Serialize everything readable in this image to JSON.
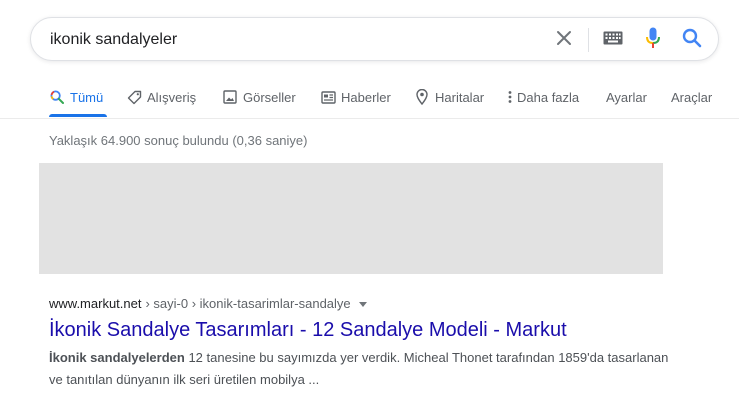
{
  "search": {
    "query": "ikonik sandalyeler"
  },
  "tabs": [
    {
      "label": "Tümü",
      "icon": "search-icon",
      "active": true
    },
    {
      "label": "Alışveriş",
      "icon": "tag-icon"
    },
    {
      "label": "Görseller",
      "icon": "image-icon"
    },
    {
      "label": "Haberler",
      "icon": "news-icon"
    },
    {
      "label": "Haritalar",
      "icon": "map-pin-icon"
    },
    {
      "label": "Daha fazla",
      "icon": "more-vert-icon"
    },
    {
      "label": "Ayarlar"
    },
    {
      "label": "Araçlar"
    }
  ],
  "stats": "Yaklaşık 64.900 sonuç bulundu (0,36 saniye)",
  "result": {
    "site": "www.markut.net",
    "breadcrumbs": "› sayi-0 › ikonik-tasarimlar-sandalye",
    "title": "İkonik Sandalye Tasarımları - 12 Sandalye Modeli - Markut",
    "snippet_bold": "İkonik sandalyelerden",
    "snippet_rest": " 12 tanesine bu sayımızda yer verdik. Micheal Thonet tarafından 1859'da tasarlanan ve tanıtılan dünyanın ilk seri üretilen mobilya ..."
  },
  "colors": {
    "accent": "#1a73e8",
    "link": "#1a0dab",
    "mic_red": "#ea4335",
    "mic_blue": "#4285f4",
    "mic_yellow": "#fbbc04",
    "mic_green": "#34a853"
  }
}
